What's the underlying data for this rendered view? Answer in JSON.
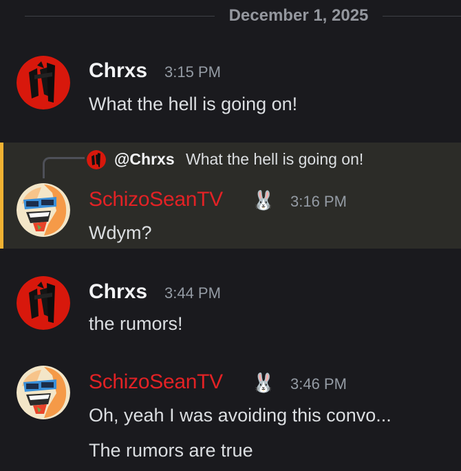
{
  "divider": {
    "date": "December 1, 2025"
  },
  "colors": {
    "username_red": "#e22225",
    "highlight_bar": "#f0b232",
    "background": "#1a1a1e"
  },
  "messages": [
    {
      "author": "Chrxs",
      "time": "3:15 PM",
      "lines": [
        "What the hell is going on!"
      ],
      "avatar": "chrxs-avatar"
    },
    {
      "author": "SchizoSeanTV",
      "badge": "🐰",
      "time": "3:16 PM",
      "lines": [
        "Wdym?"
      ],
      "avatar": "schizosean-avatar",
      "reply": {
        "mention": "@Chrxs",
        "text": "What the hell is going on!"
      }
    },
    {
      "author": "Chrxs",
      "time": "3:44 PM",
      "lines": [
        "the rumors!"
      ],
      "avatar": "chrxs-avatar"
    },
    {
      "author": "SchizoSeanTV",
      "badge": "🐰",
      "time": "3:46 PM",
      "lines": [
        "Oh, yeah I was avoiding this convo...",
        "The rumors are true"
      ],
      "avatar": "schizosean-avatar"
    }
  ]
}
